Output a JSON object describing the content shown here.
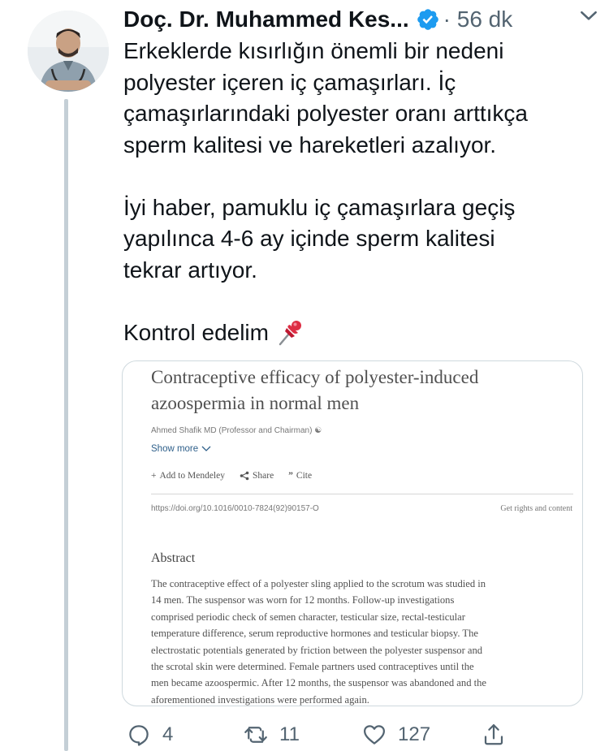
{
  "tweet": {
    "author_name": "Doç. Dr. Muhammed Kes...",
    "meta": "· 56 dk",
    "lines_p1": [
      "Erkeklerde kısırlığın önemli bir nedeni",
      "polyester içeren iç çamaşırları. İç",
      "çamaşırlarındaki polyester oranı arttıkça",
      "sperm kalitesi ve hareketleri azalıyor."
    ],
    "lines_p2": [
      "İyi haber, pamuklu iç çamaşırlara geçiş",
      "yapılınca 4-6 ay içinde sperm kalitesi",
      "tekrar artıyor."
    ],
    "closing": "Kontrol edelim",
    "closing_icon": "pushpin-icon"
  },
  "card": {
    "title_lines": [
      "Contraceptive efficacy of polyester-induced",
      "azoospermia in normal men"
    ],
    "authors": "Ahmed Shafik MD (Professor and Chairman)",
    "show_more": "Show more",
    "actions": {
      "mendeley": "Add to Mendeley",
      "share": "Share",
      "cite": "Cite"
    },
    "doi": "https://doi.org/10.1016/0010-7824(92)90157-O",
    "rights": "Get rights and content",
    "abstract_heading": "Abstract",
    "abstract_lines": [
      "The contraceptive effect of a polyester sling applied to the scrotum was studied in",
      "14 men. The suspensor was worn for 12 months. Follow-up investigations",
      "comprised periodic check of semen character, testicular size, rectal-testicular",
      "temperature difference, serum reproductive hormones and testicular biopsy. The",
      "electrostatic potentials generated by friction between the polyester suspensor and",
      "the scrotal skin were determined. Female partners used contraceptives until the",
      "men became azoospermic. After 12 months, the suspensor was abandoned and the",
      "aforementioned investigations were performed again."
    ]
  },
  "actions": {
    "reply_count": "4",
    "retweet_count": "11",
    "like_count": "127"
  },
  "colors": {
    "verified": "#1d9bf0",
    "text": "#0f1419",
    "secondary": "#536471"
  }
}
